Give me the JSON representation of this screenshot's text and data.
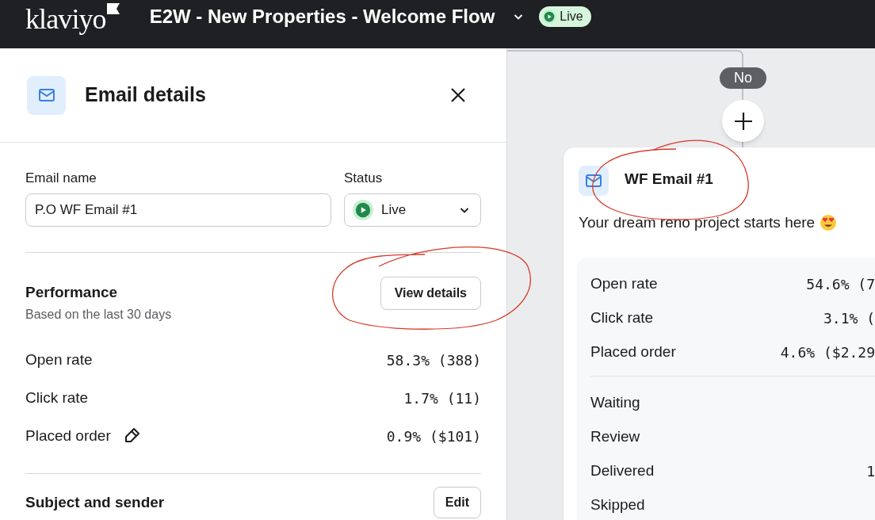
{
  "top_bar": {
    "logo": "klaviyo",
    "flow_title": "E2W - New Properties - Welcome Flow",
    "status": {
      "label": "Live",
      "kind": "live"
    }
  },
  "panel": {
    "title": "Email details",
    "email_name": {
      "label": "Email name",
      "value": "P.O WF Email #1"
    },
    "status": {
      "label": "Status",
      "value": "Live",
      "kind": "live"
    },
    "performance": {
      "title": "Performance",
      "subtitle": "Based on the last 30 days",
      "button": "View details",
      "metrics": [
        {
          "label": "Open rate",
          "value": "58.3% (388)",
          "editable": false
        },
        {
          "label": "Click rate",
          "value": "1.7% (11)",
          "editable": false
        },
        {
          "label": "Placed order",
          "value": "0.9% ($101)",
          "editable": true
        }
      ]
    },
    "next_section": {
      "title": "Subject and sender",
      "button": "Edit"
    }
  },
  "canvas": {
    "branch_label": "No",
    "card": {
      "title": "WF Email #1",
      "subject": "Your dream reno project starts here",
      "metrics": [
        {
          "label": "Open rate",
          "value": "54.6% (7"
        },
        {
          "label": "Click rate",
          "value": "3.1% ("
        },
        {
          "label": "Placed order",
          "value": "4.6% ($2.29"
        }
      ],
      "counts": [
        {
          "label": "Waiting"
        },
        {
          "label": "Review"
        },
        {
          "label": "Delivered",
          "value": "1"
        },
        {
          "label": "Skipped"
        }
      ]
    }
  }
}
